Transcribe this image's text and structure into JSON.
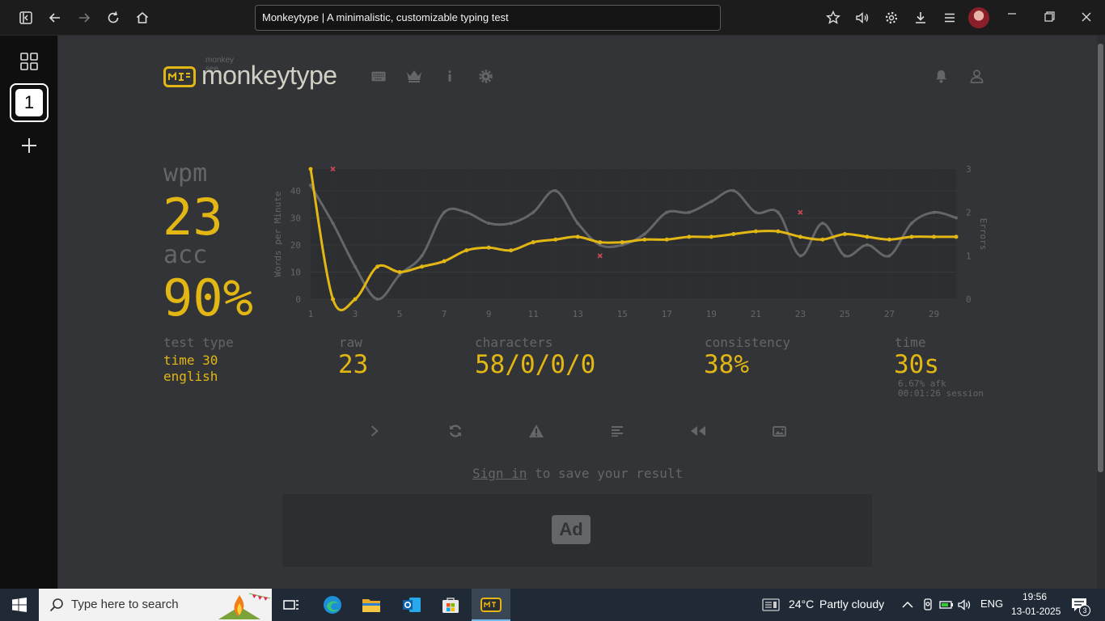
{
  "browser": {
    "url_title": "Monkeytype | A minimalistic, customizable typing test"
  },
  "sidebar": {
    "workspace_number": "1"
  },
  "header": {
    "logo_top": "monkey see",
    "logo_text": "monkeytype"
  },
  "result": {
    "wpm_label": "wpm",
    "wpm_value": "23",
    "acc_label": "acc",
    "acc_value": "90%",
    "test_type_label": "test type",
    "test_type_line1": "time 30",
    "test_type_line2": "english",
    "raw_label": "raw",
    "raw_value": "23",
    "characters_label": "characters",
    "characters_value": "58/0/0/0",
    "consistency_label": "consistency",
    "consistency_value": "38%",
    "time_label": "time",
    "time_value": "30s",
    "afk_text": "6.67% afk",
    "session_text": "00:01:26 session"
  },
  "signin": {
    "link": "Sign in",
    "rest": " to save your result"
  },
  "ad": {
    "label": "Ad"
  },
  "taskbar": {
    "search_placeholder": "Type here to search",
    "weather_temp": "24°C",
    "weather_desc": "Partly cloudy",
    "language": "ENG",
    "time": "19:56",
    "date": "13-01-2025",
    "notification_count": "3"
  },
  "colors": {
    "accent": "#e2b714",
    "bg": "#323437",
    "sub": "#646669",
    "raw_line": "#646669",
    "error": "#ca4754"
  },
  "chart_data": {
    "type": "line",
    "ylabel": "Words per Minute",
    "y2label": "Errors",
    "x_ticks": [
      "1",
      "3",
      "5",
      "7",
      "9",
      "11",
      "13",
      "15",
      "17",
      "19",
      "21",
      "23",
      "25",
      "27",
      "29"
    ],
    "y_ticks": [
      "0",
      "10",
      "20",
      "30",
      "40"
    ],
    "y2_ticks": [
      "0",
      "1",
      "2",
      "3"
    ],
    "ylim": [
      0,
      48
    ],
    "y2lim": [
      0,
      3
    ],
    "xlim": [
      1,
      30
    ],
    "series": [
      {
        "name": "wpm",
        "x": [
          1,
          2,
          3,
          4,
          5,
          6,
          7,
          8,
          9,
          10,
          11,
          12,
          13,
          14,
          15,
          16,
          17,
          18,
          19,
          20,
          21,
          22,
          23,
          24,
          25,
          26,
          27,
          28,
          29,
          30
        ],
        "values": [
          48,
          0,
          0,
          12,
          10,
          12,
          14,
          18,
          19,
          18,
          21,
          22,
          23,
          21,
          21,
          22,
          22,
          23,
          23,
          24,
          25,
          25,
          23,
          22,
          24,
          23,
          22,
          23,
          23,
          23
        ]
      },
      {
        "name": "raw",
        "x": [
          1,
          2,
          3,
          4,
          5,
          6,
          7,
          8,
          9,
          10,
          11,
          12,
          13,
          14,
          15,
          16,
          17,
          18,
          19,
          20,
          21,
          22,
          23,
          24,
          25,
          26,
          27,
          28,
          29,
          30
        ],
        "values": [
          42,
          28,
          12,
          0,
          9,
          16,
          32,
          32,
          28,
          28,
          32,
          40,
          28,
          20,
          20,
          24,
          32,
          32,
          36,
          40,
          32,
          32,
          16,
          28,
          16,
          20,
          16,
          28,
          32,
          30
        ]
      }
    ],
    "errors": [
      {
        "x": 2,
        "value": 3
      },
      {
        "x": 14,
        "value": 1
      },
      {
        "x": 23,
        "value": 2
      }
    ]
  }
}
